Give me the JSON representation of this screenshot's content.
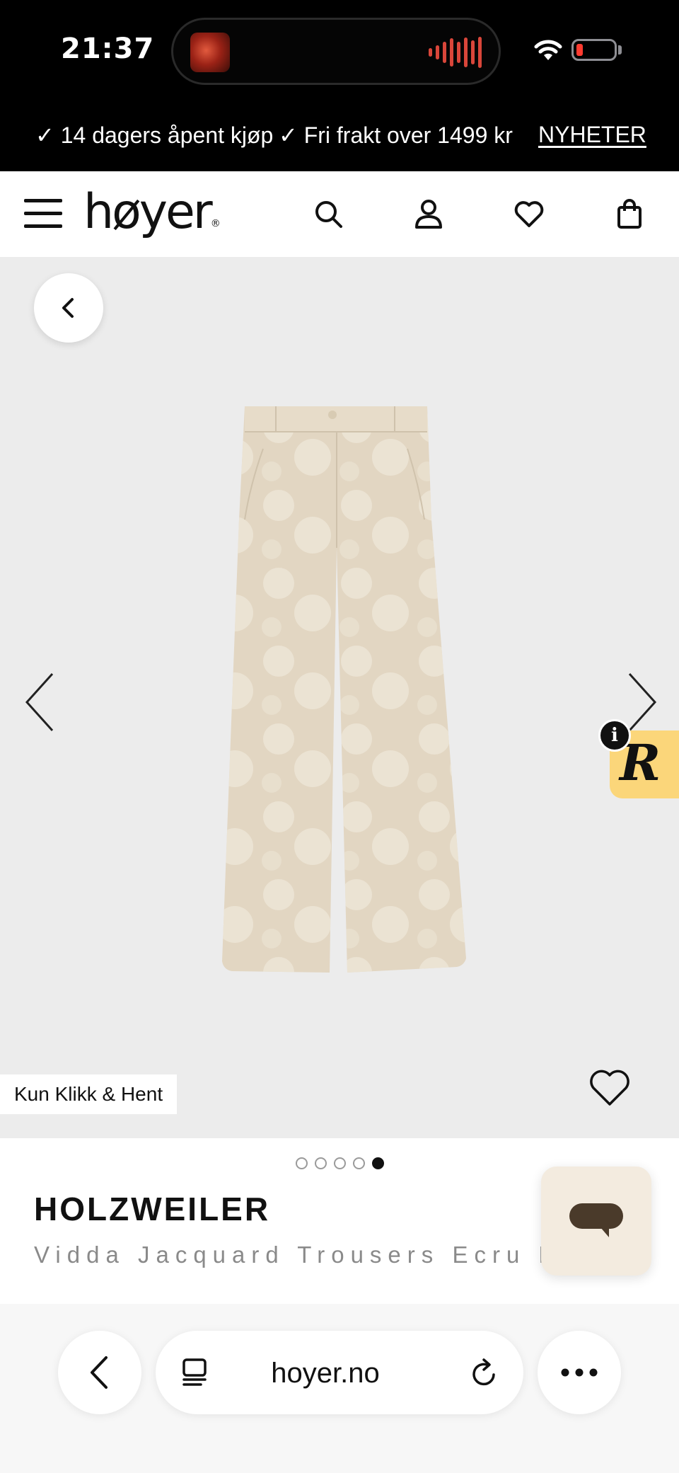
{
  "status_bar": {
    "time": "21:37",
    "battery_level": 0.1,
    "wifi": "wifi-icon",
    "now_playing": "waveform-icon"
  },
  "promo": {
    "item1": "✓ 14 dagers åpent kjøp",
    "item2": "✓ Fri frakt over 1499 kr",
    "link": "NYHETER"
  },
  "header": {
    "logo": "høyer",
    "logo_mark": "®",
    "icons": [
      "menu-icon",
      "search-icon",
      "account-icon",
      "heart-icon",
      "bag-icon"
    ]
  },
  "gallery": {
    "badge": "Kun Klikk & Hent",
    "info_icon": "i",
    "r_badge": "R",
    "image_count": 5,
    "active_image": 5,
    "background": "#ececec"
  },
  "product": {
    "brand": "HOLZWEILER",
    "name": "Vidda Jacquard Trousers Ecru Mi"
  },
  "browser": {
    "url": "hoyer.no"
  },
  "colors": {
    "accent_badge": "#fbd67a",
    "chat_bg": "#f3ebdf",
    "chat_bubble": "#4a3a2a",
    "trousers": "#e4d9c6"
  }
}
